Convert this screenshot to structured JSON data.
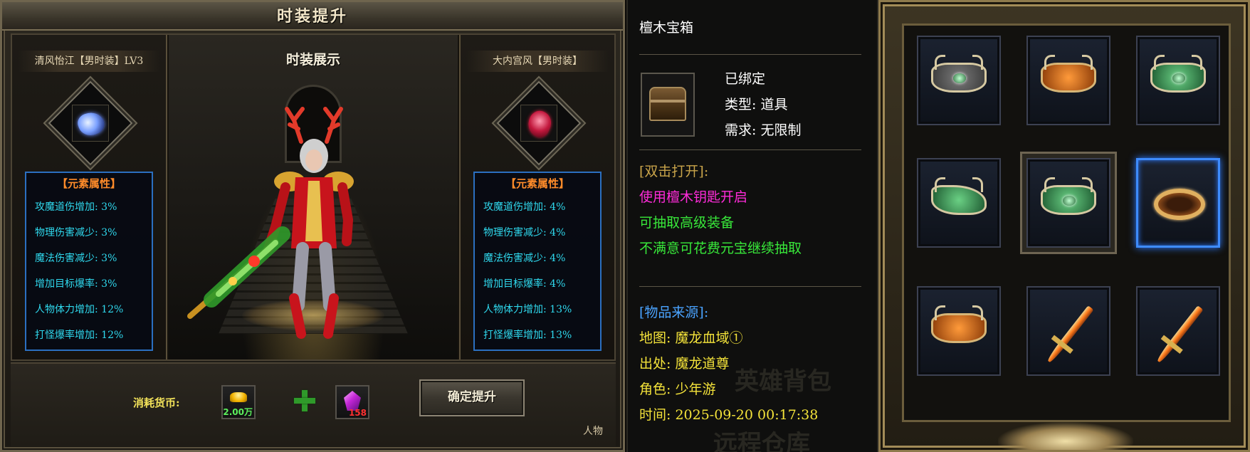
{
  "left_panel": {
    "title": "时装提升",
    "current": {
      "name": "清风怡江【男时装】LV3",
      "icon": "blue-glove-icon",
      "attr_title": "【元素属性】",
      "attrs": [
        "攻魔道伤增加: 3%",
        "物理伤害减少: 3%",
        "魔法伤害减少: 3%",
        "增加目标爆率: 3%",
        "人物体力增加: 12%",
        "打怪爆率增加: 12%"
      ]
    },
    "preview_title": "时装展示",
    "next": {
      "name": "大内宫风【男时装】",
      "icon": "red-glove-icon",
      "attr_title": "【元素属性】",
      "attrs": [
        "攻魔道伤增加: 4%",
        "物理伤害减少: 4%",
        "魔法伤害减少: 4%",
        "增加目标爆率: 4%",
        "人物体力增加: 13%",
        "打怪爆率增加: 13%"
      ]
    },
    "cost_label": "消耗货币:",
    "cost_gold": "2.00万",
    "cost_gem": "158",
    "confirm_label": "确定提升",
    "corner_tag": "人物",
    "colors": {
      "attr_text": "#2fd9ee",
      "attr_title": "#ff8c2a",
      "attr_border": "#2b6fc0"
    }
  },
  "tooltip": {
    "item_name": "檀木宝箱",
    "item_icon": "wooden-chest-icon",
    "bound": "已绑定",
    "type": "类型: 道具",
    "requirement": "需求: 无限制",
    "usage_header": "[双击打开]:",
    "usage_line1": "使用檀木钥匙开启",
    "usage_line2": "可抽取高级装备",
    "usage_line3": "不满意可花费元宝继续抽取",
    "source_header": "[物品来源]:",
    "map": "地图: 魔龙血域①",
    "origin": "出处: 魔龙道尊",
    "role": "角色: 少年游",
    "time": "时间: 2025-09-20 00:17:38",
    "bg_texts": [
      "英雄背包",
      "远程仓库"
    ],
    "colors": {
      "header": "#c9a44a",
      "magenta": "#ff2bd9",
      "green": "#38e83a",
      "source": "#4aa3ff",
      "yellow": "#f4e33a"
    }
  },
  "grid": {
    "items": [
      {
        "icon": "silver-belt-icon"
      },
      {
        "icon": "orange-belt-icon"
      },
      {
        "icon": "green-belt-icon"
      },
      {
        "icon": "jade-boots-icon"
      },
      {
        "icon": "green-belt-icon"
      },
      {
        "icon": "gold-ring-icon",
        "selected": true
      },
      {
        "icon": "orange-belt-icon"
      },
      {
        "icon": "flame-sword-icon"
      },
      {
        "icon": "flame-sword-icon"
      }
    ],
    "selected_color": "#3e8cff"
  }
}
